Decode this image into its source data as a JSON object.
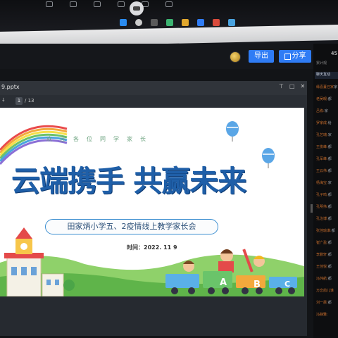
{
  "top_toolbar": {
    "items": [
      "",
      "",
      "",
      "",
      "",
      "",
      ""
    ],
    "record_label": ""
  },
  "app": {
    "export_label": "导出",
    "share_label": "分享"
  },
  "file": {
    "name": "9.pptx",
    "current_page": "1",
    "total_pages": "/ 13",
    "prev_icon": "chevron-left-icon",
    "controls": [
      "⊤",
      "□",
      "✕"
    ]
  },
  "slide": {
    "subheading": "欢迎各位同学家长",
    "title": "云端携手 共赢未来",
    "school_line": "田家炳小学五、2疫情线上教学家长会",
    "date": "时间：2022. 11 9",
    "train_letters": [
      "A",
      "B",
      "C"
    ]
  },
  "right_panel": {
    "viewer_count": "45",
    "viewer_label": "累计观",
    "chat_tab": "聊天互动",
    "chat_lines": [
      {
        "name": "缘喜蔓已家",
        "msg": "家"
      },
      {
        "name": "老吴眼:",
        "msg": "都"
      },
      {
        "name": "吕栋:",
        "msg": "家"
      },
      {
        "name": "罗家成:",
        "msg": "给"
      },
      {
        "name": "孔艺瑞:",
        "msg": "家"
      },
      {
        "name": "王俊峰:",
        "msg": "都"
      },
      {
        "name": "孔军峰:",
        "msg": "都"
      },
      {
        "name": "王云伟:",
        "msg": "都"
      },
      {
        "name": "杨海宝:",
        "msg": "家"
      },
      {
        "name": "孔子鸣:",
        "msg": "都"
      },
      {
        "name": "孔明伟:",
        "msg": "都"
      },
      {
        "name": "孔治博:",
        "msg": "都"
      },
      {
        "name": "张佳瑜谁:",
        "msg": "都"
      },
      {
        "name": "崔广盈:",
        "msg": "都"
      },
      {
        "name": "李鹏轩:",
        "msg": "都"
      },
      {
        "name": "王佳悦:",
        "msg": "都"
      },
      {
        "name": "冯炜航:",
        "msg": "都"
      },
      {
        "name": "万恋鸽儿谁",
        "msg": ""
      },
      {
        "name": "刘一晨:",
        "msg": "都"
      },
      {
        "name": "冯静雅:",
        "msg": ""
      }
    ]
  },
  "colors": {
    "accent": "#2f7cf5",
    "title_blue": "#1f5fa8",
    "chat_name": "#c46b2b"
  }
}
